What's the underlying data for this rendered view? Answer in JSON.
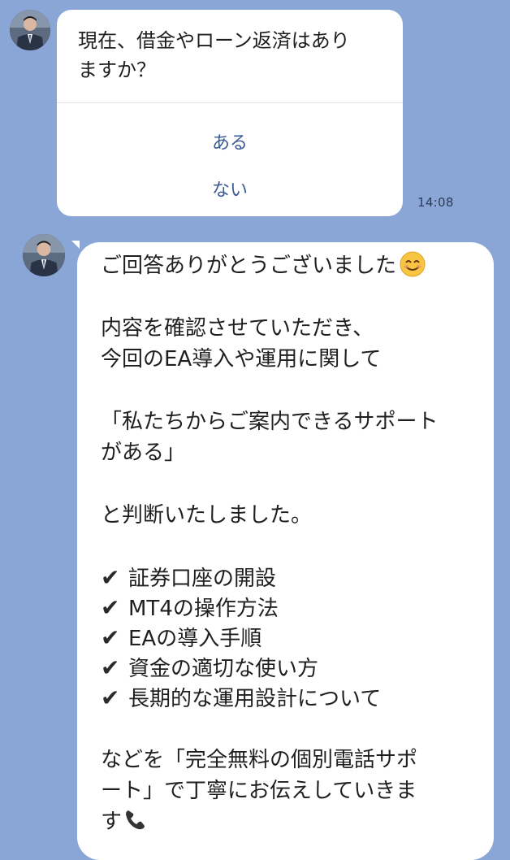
{
  "messages": [
    {
      "question_line1": "現在、借金やローン返済はあり",
      "question_line2": "ますか？",
      "options": [
        "ある",
        "ない"
      ],
      "time": "14:08"
    },
    {
      "line1": "ご回答ありがとうございました",
      "line2": "内容を確認させていただき、",
      "line3": "今回のEA導入や運用に関して",
      "line4": "「私たちからご案内できるサポート",
      "line5": "がある」",
      "line6": "と判断いたしました。",
      "checklist": [
        "証券口座の開設",
        "MT4の操作方法",
        "EAの導入手順",
        "資金の適切な使い方",
        "長期的な運用設計について"
      ],
      "line7": "などを「完全無料の個別電話サポ",
      "line8": "ート」で丁寧にお伝えしていきま",
      "line9": "す",
      "check_symbol": "✔",
      "emoji_smile": "smiling-face-emoji",
      "emoji_phone": "telephone-receiver-emoji"
    }
  ],
  "colors": {
    "background": "#8aa6d6",
    "bubble": "#ffffff",
    "option_text": "#3c5a93"
  }
}
